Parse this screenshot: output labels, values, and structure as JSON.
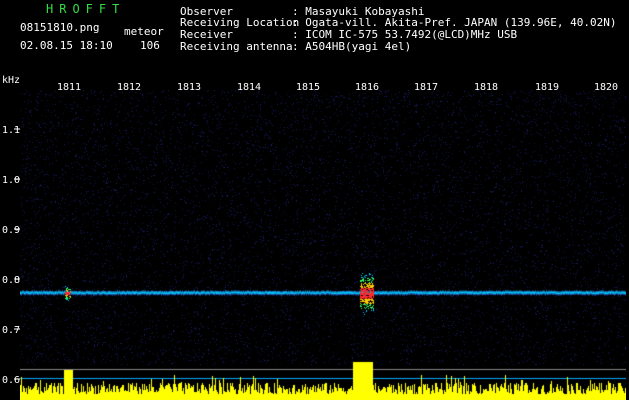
{
  "header": {
    "brand": "HROFFT",
    "filename": "08151810.png",
    "mode": "meteor",
    "datetime": "02.08.15 18:10",
    "count": "106"
  },
  "info": [
    {
      "label": "Observer",
      "value": ": Masayuki Kobayashi"
    },
    {
      "label": "Receiving Location",
      "value": ": Ogata-vill. Akita-Pref. JAPAN (139.96E, 40.02N)"
    },
    {
      "label": "Receiver",
      "value": ": ICOM IC-575 53.7492(@LCD)MHz USB"
    },
    {
      "label": "Receiving antenna",
      "value": ": A504HB(yagi 4el)"
    }
  ],
  "axes": {
    "y_unit": "kHz",
    "y_ticks": [
      "1.1",
      "1.0",
      "0.9",
      "0.8",
      "0.7",
      "0.6"
    ],
    "x_ticks": [
      "1811",
      "1812",
      "1813",
      "1814",
      "1815",
      "1816",
      "1817",
      "1818",
      "1819",
      "1820"
    ]
  },
  "colors": {
    "background": "#000000",
    "brand": "#33dd44",
    "noise": "#1a1f5a",
    "signal_line": "#00c8ff",
    "meteor_core": "#ff2a2a",
    "bars": "#ffff00"
  }
}
